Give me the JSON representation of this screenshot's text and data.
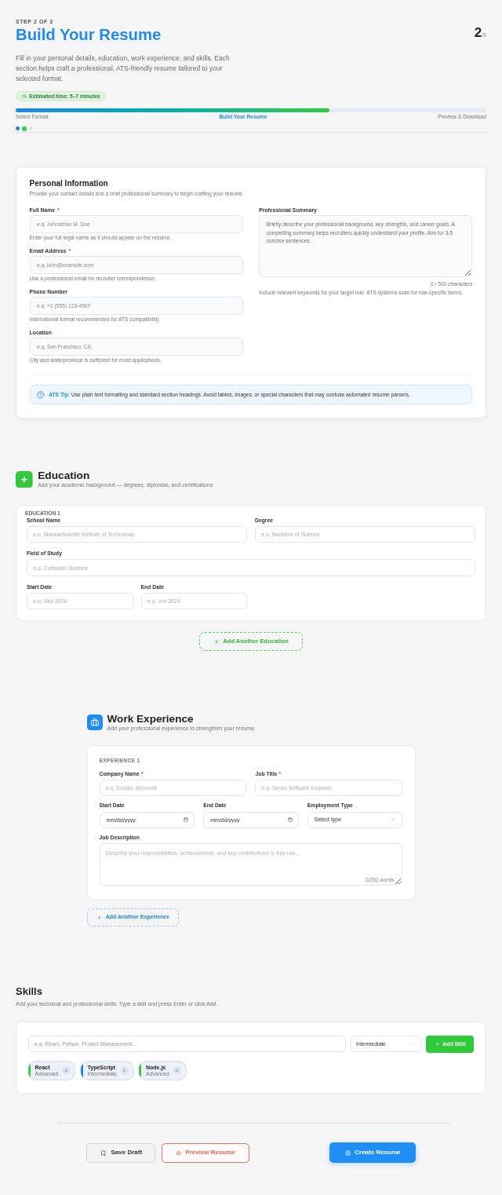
{
  "header": {
    "step_label": "STEP 2 OF 3",
    "title": "Build Your Resume",
    "step_counter": {
      "current": "2",
      "total": "/3"
    },
    "description": "Fill in your personal details, education, work experience, and skills. Each section helps craft a professional, ATS-friendly resume tailored to your selected format.",
    "estimate": "Estimated time: 5–7 minutes",
    "progress": {
      "level": 0.666,
      "steps": [
        {
          "label": "Select Format",
          "selected": false
        },
        {
          "label": "Build Your Resume",
          "selected": true
        },
        {
          "label": "Preview & Download",
          "selected": false
        }
      ]
    },
    "step_dots": [
      {
        "kind": "complete"
      },
      {
        "kind": "current"
      },
      {
        "kind": "pending"
      }
    ]
  },
  "required_mark": "*",
  "personal": {
    "title": "Personal Information",
    "subtitle": "Provide your contact details and a brief professional summary to begin crafting your resume.",
    "fields": [
      {
        "label": "Full Name",
        "required": true,
        "placeholder": "e.g. Johnathan M. Doe",
        "hint": "Enter your full legal name as it should appear on the resume."
      },
      {
        "label": "Email Address",
        "required": true,
        "placeholder": "e.g. john@example.com",
        "hint": "Use a professional email for recruiter correspondence."
      },
      {
        "label": "Phone Number",
        "required": false,
        "placeholder": "e.g. +1 (555) 123-4567",
        "hint": "International format recommended for ATS compatibility."
      },
      {
        "label": "Location",
        "required": false,
        "placeholder": "e.g. San Francisco, CA",
        "hint": "City and state/province is sufficient for most applications."
      }
    ],
    "summary": {
      "label": "Professional Summary",
      "placeholder": "Briefly describe your professional background, key strengths, and career goals. A compelling summary helps recruiters quickly understand your profile. Aim for 3-5 concise sentences.",
      "counter": "0 / 500 characters",
      "hint": "Include relevant keywords for your target role. ATS systems scan for role-specific terms."
    },
    "tip": "**ATS Tip:** Use plain text formatting and standard section headings. Avoid tables, images, or special characters that may confuse automated resume parsers."
  },
  "education": {
    "title": "Education",
    "subtitle": "Add your academic background — degrees, diplomas, and certifications",
    "entries": [
      {
        "heading": "EDUCATION 1",
        "fields": [
          {
            "label": "School Name",
            "placeholder": "e.g. Massachusetts Institute of Technology"
          },
          {
            "label": "Degree",
            "placeholder": "e.g. Bachelor of Science"
          },
          {
            "label": "Field of Study",
            "placeholder": "e.g. Computer Science"
          },
          {
            "label": "Start Date",
            "placeholder": "e.g. Sep 2020"
          },
          {
            "label": "End Date",
            "placeholder": "e.g. Jun 2024"
          }
        ]
      }
    ],
    "add_button": "Add Another Education"
  },
  "experience": {
    "title": "Work Experience",
    "subtitle": "Add your professional experience to strengthen your resume",
    "entries": [
      {
        "heading": "EXPERIENCE 1",
        "fields": [
          {
            "kind": "text",
            "label": "Company Name",
            "required": true,
            "placeholder": "e.g. Google, Microsoft"
          },
          {
            "kind": "text",
            "label": "Job Title",
            "required": true,
            "placeholder": "e.g. Senior Software Engineer"
          },
          {
            "kind": "date",
            "label": "Start Date",
            "required": false,
            "placeholder": "mm/dd/yyyy"
          },
          {
            "kind": "date",
            "label": "End Date",
            "required": false,
            "placeholder": "mm/dd/yyyy"
          },
          {
            "kind": "select",
            "label": "Employment Type",
            "required": false,
            "placeholder": "Select type"
          },
          {
            "kind": "textarea",
            "label": "Job Description",
            "required": false,
            "placeholder": "Describe your responsibilities, achievements, and key contributions in this role...",
            "counter": "0/200 words"
          }
        ]
      }
    ],
    "add_button": "Add Another Experience"
  },
  "skills": {
    "title": "Skills",
    "subtitle": "Add your technical and professional skills. Type a skill and press Enter or click Add.",
    "input": {
      "placeholder": "e.g. React, Python, Project Management..."
    },
    "proficiency_select": {
      "value": "Intermediate"
    },
    "add_button": "Add Skill",
    "chips": [
      {
        "name": "React",
        "proficiency": "Advanced",
        "color": "#2ecc40"
      },
      {
        "name": "TypeScript",
        "proficiency": "Intermediate",
        "color": "#1e88e5"
      },
      {
        "name": "Node.js",
        "proficiency": "Advanced",
        "color": "#2ecc40"
      }
    ]
  },
  "actions": [
    {
      "kind": "secondary",
      "label": "Save Draft"
    },
    {
      "kind": "outline",
      "label": "Preview Resume"
    },
    {
      "kind": "primary",
      "label": "Create Resume"
    }
  ]
}
